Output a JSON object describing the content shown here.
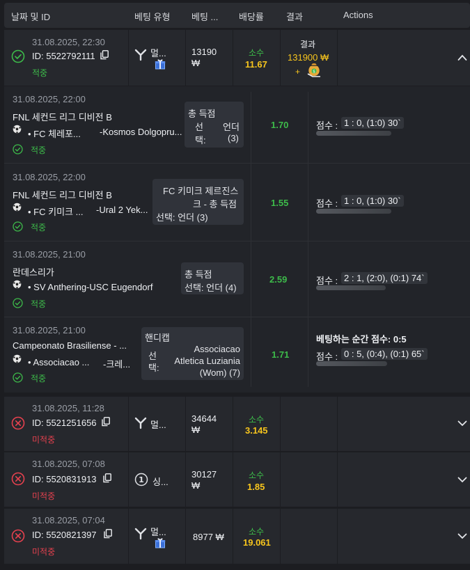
{
  "header": {
    "col_date": "날짜 및 ID",
    "col_type": "베팅 유형",
    "col_amount": "베팅 ...",
    "col_odds": "배당률",
    "col_result": "결과",
    "col_actions": "Actions"
  },
  "expanded_bet": {
    "datetime": "31.08.2025, 22:30",
    "id_label": "ID: 5522792111",
    "status": "적중",
    "type_label": "멀...",
    "amount": "13190",
    "currency": "₩",
    "odds_label": "소수",
    "odds": "11.67",
    "result_label": "결과",
    "result_amount": "131900 ₩",
    "result_plus": "+"
  },
  "events": [
    {
      "datetime": "31.08.2025, 22:00",
      "league": "FNL 세컨드 리그 디비전 B",
      "teams_left": "• FC 체레포...",
      "teams_right": "-Kosmos Dolgopru...",
      "status": "적중",
      "selection_title": "총 득점",
      "selection_key": "선택:",
      "selection_value": "언더 (3)",
      "odds": "1.70",
      "score_label": "점수 :",
      "score": "1 : 0, (1:0) 30`"
    },
    {
      "datetime": "31.08.2025, 22:00",
      "league": "FNL 세컨드 리그 디비전 B",
      "teams_left": "• FC 키미크 ...",
      "teams_right": "-Ural 2 Yek...",
      "status": "적중",
      "selection_title": "FC 키미크 제르진스크 - 총 득점",
      "selection_line1": "FC 키미크 제르진스",
      "selection_line2": "크 - 총 득점",
      "selection_value": "선택: 언더 (3)",
      "odds": "1.55",
      "score_label": "점수 :",
      "score": "1 : 0, (1:0) 30`"
    },
    {
      "datetime": "31.08.2025, 21:00",
      "league": "란데스리가",
      "teams_left": "• SV Anthering-USC Eugendorf",
      "status": "적중",
      "selection_title": "총 득점",
      "selection_value": "선택: 언더 (4)",
      "odds": "2.59",
      "score_label": "점수 :",
      "score": "2 : 1, (2:0), (0:1) 74`"
    },
    {
      "datetime": "31.08.2025, 21:00",
      "league": "Campeonato Brasiliense - ...",
      "teams_left": "• Associacao ...",
      "teams_right": "-크레...",
      "status": "적중",
      "selection_title": "핸디캡",
      "selection_key": "선택:",
      "selection_value_1": "Associacao",
      "selection_value_2": "Atletica Luziania",
      "selection_value_3": "(Wom) (7)",
      "odds": "1.71",
      "live_score_label": "베팅하는 순간 점수: 0:5",
      "score_label": "점수 :",
      "score": "0 : 5, (0:4), (0:1) 65`"
    }
  ],
  "bets": [
    {
      "datetime": "31.08.2025, 11:28",
      "id_label": "ID: 5521251656",
      "status": "미적중",
      "type_label": "멀...",
      "type_icon": "multi-bet-icon",
      "amount": "34644",
      "currency": "₩",
      "odds_label": "소수",
      "odds": "3.145"
    },
    {
      "datetime": "31.08.2025, 07:08",
      "id_label": "ID: 5520831913",
      "status": "미적중",
      "type_label": "싱...",
      "type_icon": "single-bet-icon",
      "amount": "30127",
      "currency": "₩",
      "odds_label": "소수",
      "odds": "1.85"
    },
    {
      "datetime": "31.08.2025, 07:04",
      "id_label": "ID: 5520821397",
      "status": "미적중",
      "type_label": "멀...",
      "type_icon": "multi-bet-icon",
      "amount": "8977 ₩",
      "odds_label": "소수",
      "odds": "19.061"
    }
  ],
  "colors": {
    "win": "#3dbb4a",
    "loss": "#e5414e",
    "odds": "#f7c51d",
    "background": "#1c1d21",
    "panel": "#26282d"
  }
}
